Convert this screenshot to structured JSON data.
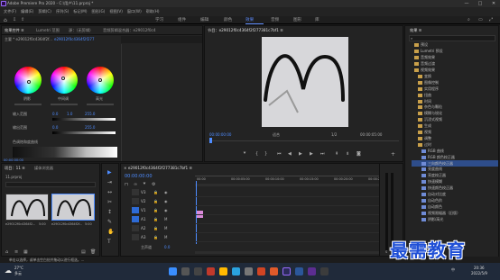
{
  "window": {
    "title": "Adobe Premiere Pro 2020 - C:\\用户\\11.prproj *",
    "min": "—",
    "max": "□",
    "close": "✕"
  },
  "menu": [
    "文件(F)",
    "编辑(E)",
    "剪辑(C)",
    "序列(S)",
    "标记(M)",
    "图形(G)",
    "视图(V)",
    "窗口(W)",
    "帮助(H)"
  ],
  "workspaces": [
    {
      "label": "学习",
      "active": false
    },
    {
      "label": "组件",
      "active": false
    },
    {
      "label": "编辑",
      "active": false
    },
    {
      "label": "颜色",
      "active": false
    },
    {
      "label": "效果",
      "active": true
    },
    {
      "label": "音频",
      "active": false
    },
    {
      "label": "图形",
      "active": false
    },
    {
      "label": "库",
      "active": false
    }
  ],
  "effect_controls": {
    "tabs": [
      "效果控件 ≡",
      "Lumetri 范围",
      "源：（无剪辑）",
      "音频剪辑混合器：e29012f0c4"
    ],
    "clip_label": "主要 * e29012f0c4364f2f...",
    "seq_label": "e29012f0c4364f2f277",
    "wheel_labels": [
      "阴影",
      "中间调",
      "高光"
    ],
    "in_range_label": "输入范围",
    "in_range_values": [
      "0.0",
      "1.0",
      "255.0"
    ],
    "out_range_label": "输出范围",
    "out_range_values": [
      "0.0",
      "",
      "255.0"
    ],
    "hue_label": "色调饱和度曲线",
    "timecode": "00:00:00:00"
  },
  "program": {
    "tab": "节目：e29012f0c4364f2f277381c7bf1 ≡",
    "timecode_left": "00:00:00:00",
    "fit": "适合",
    "ratio": "1/2",
    "timecode_right": "00:00:05:00"
  },
  "effects_panel": {
    "tab": "效果 ≡",
    "items": [
      {
        "label": "预设",
        "indent": 0,
        "icon": "folder",
        "hl": false
      },
      {
        "label": "Lumetri 预设",
        "indent": 0,
        "icon": "folder",
        "hl": false
      },
      {
        "label": "音频效果",
        "indent": 0,
        "icon": "folder",
        "hl": false
      },
      {
        "label": "音频过渡",
        "indent": 0,
        "icon": "folder",
        "hl": false
      },
      {
        "label": "视频效果",
        "indent": 0,
        "icon": "folder",
        "hl": false
      },
      {
        "label": "变换",
        "indent": 1,
        "icon": "folder",
        "hl": false
      },
      {
        "label": "图像控制",
        "indent": 1,
        "icon": "folder",
        "hl": false
      },
      {
        "label": "实用程序",
        "indent": 1,
        "icon": "folder",
        "hl": false
      },
      {
        "label": "扭曲",
        "indent": 1,
        "icon": "folder",
        "hl": false
      },
      {
        "label": "时间",
        "indent": 1,
        "icon": "folder",
        "hl": false
      },
      {
        "label": "杂色与颗粒",
        "indent": 1,
        "icon": "folder",
        "hl": false
      },
      {
        "label": "模糊与锐化",
        "indent": 1,
        "icon": "folder",
        "hl": false
      },
      {
        "label": "沉浸式视频",
        "indent": 1,
        "icon": "folder",
        "hl": false
      },
      {
        "label": "生成",
        "indent": 1,
        "icon": "folder",
        "hl": false
      },
      {
        "label": "视频",
        "indent": 1,
        "icon": "folder",
        "hl": false
      },
      {
        "label": "调整",
        "indent": 1,
        "icon": "folder",
        "hl": false
      },
      {
        "label": "过时",
        "indent": 1,
        "icon": "folder",
        "hl": false
      },
      {
        "label": "RGB 曲线",
        "indent": 2,
        "icon": "fx",
        "hl": false
      },
      {
        "label": "RGB 颜色校正器",
        "indent": 2,
        "icon": "fx",
        "hl": false
      },
      {
        "label": "三向颜色校正器",
        "indent": 2,
        "icon": "fx",
        "hl": true
      },
      {
        "label": "亮度曲线",
        "indent": 2,
        "icon": "fx",
        "hl": false
      },
      {
        "label": "亮度校正器",
        "indent": 2,
        "icon": "fx",
        "hl": false
      },
      {
        "label": "快速模糊",
        "indent": 2,
        "icon": "fx",
        "hl": false
      },
      {
        "label": "快速颜色校正器",
        "indent": 2,
        "icon": "fx",
        "hl": false
      },
      {
        "label": "自动对比度",
        "indent": 2,
        "icon": "fx",
        "hl": false
      },
      {
        "label": "自动色阶",
        "indent": 2,
        "icon": "fx",
        "hl": false
      },
      {
        "label": "自动颜色",
        "indent": 2,
        "icon": "fx",
        "hl": false
      },
      {
        "label": "视频限幅器（旧版）",
        "indent": 2,
        "icon": "fx",
        "hl": false
      },
      {
        "label": "阴影/高光",
        "indent": 2,
        "icon": "fx",
        "hl": false
      }
    ]
  },
  "project": {
    "tabs": [
      "项目：11 ≡",
      "媒体浏览器"
    ],
    "file": "11.prproj",
    "clips": [
      {
        "name": "e29012f0c4364f2...",
        "dur": "5:00"
      },
      {
        "name": "e29012f0c4364f2f...",
        "dur": "5:00"
      }
    ]
  },
  "timeline": {
    "tab": "× e29012f0c4364f2f277381c7bf1 ≡",
    "timecode": "00:00:00:00",
    "ruler": [
      "00:00",
      "00:00:05:00",
      "00:00:10:00",
      "00:00:15:00",
      "00:00:20:00",
      "00:00:25:00"
    ],
    "tracks": [
      "V3",
      "V2",
      "V1",
      "A1",
      "A2",
      "A3"
    ],
    "master": "主声道",
    "master_val": "0.0"
  },
  "status": "单击以选择，或单击空白处并拖动以进行框选。...",
  "watermark": "最需教育",
  "taskbar": {
    "weather_temp": "27°C",
    "weather_desc": "多云",
    "lang": "中",
    "time": "20:36",
    "date": "2022/5/9"
  },
  "colors": {
    "accent": "#4e8cff",
    "highlight": "#2e4d8a",
    "watermark": "#1f4fd6",
    "playhead": "#4e8cff"
  }
}
